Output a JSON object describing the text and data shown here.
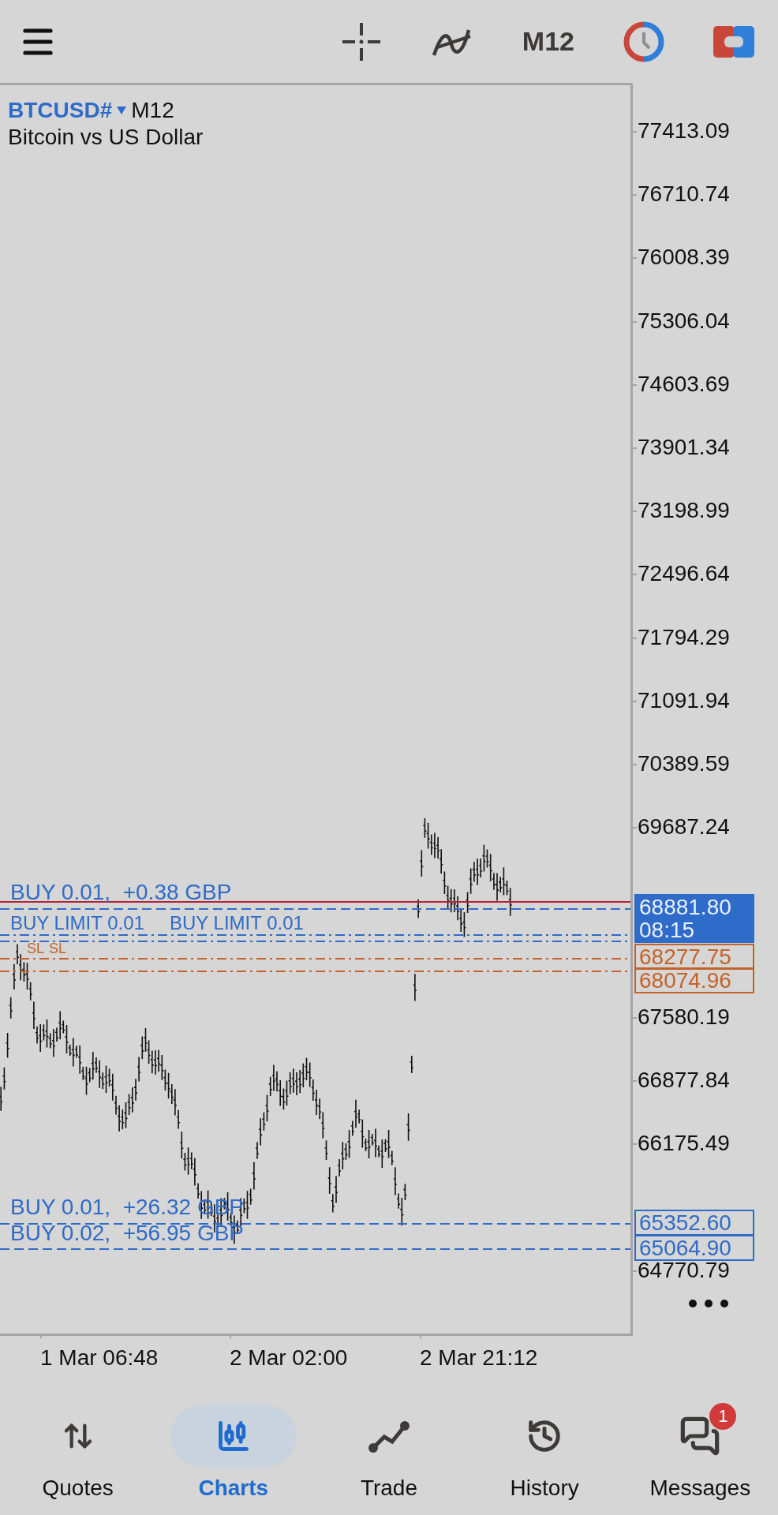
{
  "top_bar": {
    "timeframe": "M12"
  },
  "chart": {
    "symbol": "BTCUSD#",
    "timeframe": "M12",
    "description": "Bitcoin vs US Dollar",
    "price_axis": [
      "77413.09",
      "76710.74",
      "76008.39",
      "75306.04",
      "74603.69",
      "73901.34",
      "73198.99",
      "72496.64",
      "71794.29",
      "71091.94",
      "70389.59",
      "69687.24",
      "67580.19",
      "66877.84",
      "66175.49",
      "64770.79"
    ],
    "time_axis": [
      "1 Mar 06:48",
      "2 Mar 02:00",
      "2 Mar 21:12"
    ],
    "order_lines": [
      {
        "kind": "position",
        "label": "BUY 0.01,  +0.38 GBP"
      },
      {
        "kind": "limit",
        "label": "BUY LIMIT 0.01"
      },
      {
        "kind": "limit",
        "label": "BUY LIMIT 0.01"
      },
      {
        "kind": "stop_loss",
        "label": "SL"
      },
      {
        "kind": "stop_loss",
        "label": "SL"
      },
      {
        "kind": "position",
        "label": "BUY 0.01,  +26.32 GBP"
      },
      {
        "kind": "position",
        "label": "BUY 0.02,  +56.95 GBP"
      }
    ],
    "price_tags": [
      {
        "kind": "current",
        "price": "68881.80",
        "time": "08:15"
      },
      {
        "kind": "stop_loss",
        "price": "68277.75"
      },
      {
        "kind": "stop_loss",
        "price": "68074.96"
      },
      {
        "kind": "position",
        "price": "65352.60"
      },
      {
        "kind": "position",
        "price": "65064.90"
      }
    ]
  },
  "nav": [
    {
      "kind": "quotes",
      "label": "Quotes",
      "selected": false
    },
    {
      "kind": "charts",
      "label": "Charts",
      "selected": true
    },
    {
      "kind": "trade",
      "label": "Trade",
      "selected": false
    },
    {
      "kind": "history",
      "label": "History",
      "selected": false
    },
    {
      "kind": "messages",
      "label": "Messages",
      "selected": false,
      "badge": "1"
    }
  ]
}
